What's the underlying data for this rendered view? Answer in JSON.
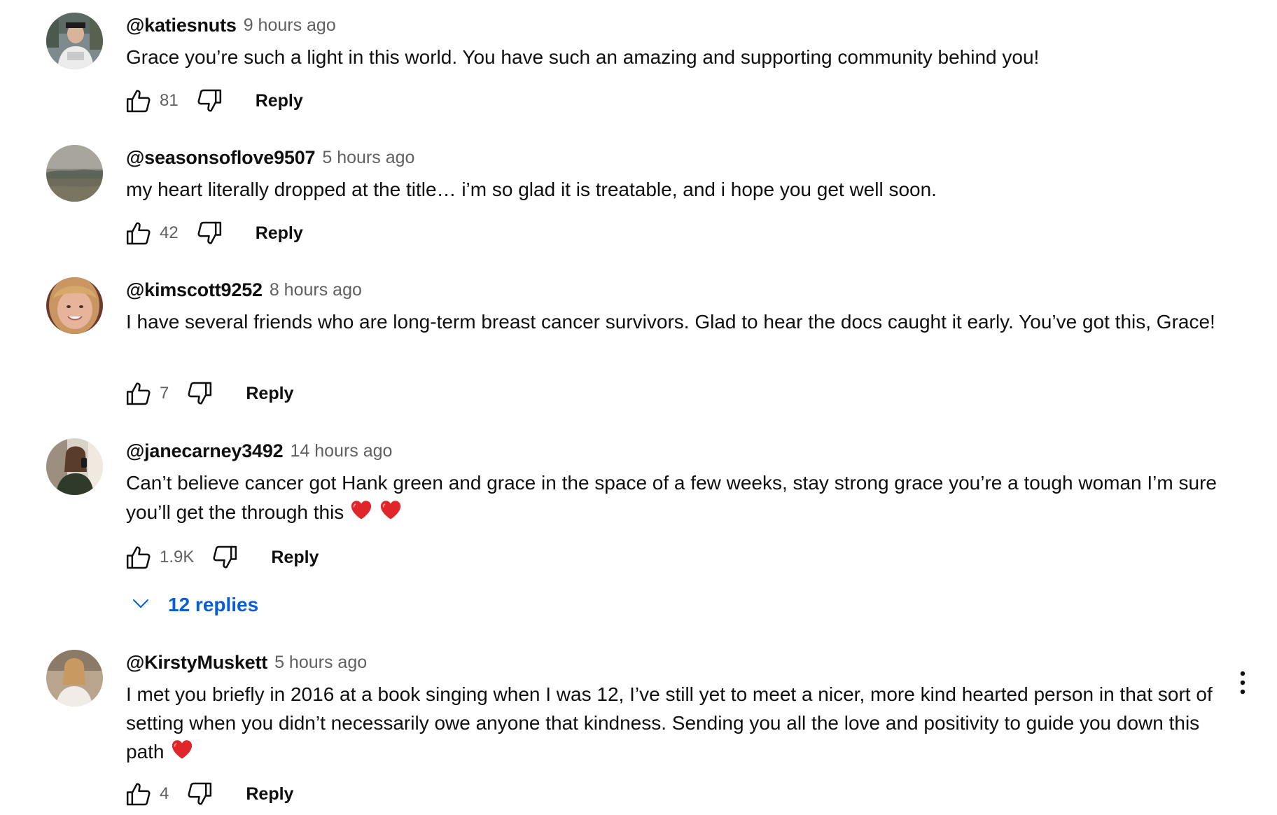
{
  "comments": [
    {
      "author": "@katiesnuts",
      "time": "9 hours ago",
      "text": "Grace you’re such a light in this world. You have such an amazing and supporting community behind you!",
      "likes": "81",
      "reply_label": "Reply",
      "avatar": "graduate-photo-avatar"
    },
    {
      "author": "@seasonsoflove9507",
      "time": "5 hours ago",
      "text": "my heart literally dropped at the title… i’m so glad it is treatable, and i hope you get well soon.",
      "likes": "42",
      "reply_label": "Reply",
      "avatar": "landscape-photo-avatar"
    },
    {
      "author": "@kimscott9252",
      "time": "8 hours ago",
      "text": "I have several friends who are long-term breast cancer survivors. Glad  to hear the docs caught it early. You’ve got this, Grace!",
      "likes": "7",
      "reply_label": "Reply",
      "avatar": "smiling-woman-avatar"
    },
    {
      "author": "@janecarney3492",
      "time": "14 hours ago",
      "text": "Can’t believe cancer got Hank green and grace in the space of a few weeks, stay strong grace you’re a tough woman I’m sure you’ll get the through this",
      "likes": "1.9K",
      "reply_label": "Reply",
      "replies_label": "12 replies",
      "avatar": "mirror-selfie-avatar"
    },
    {
      "author": "@KirstyMuskett",
      "time": "5 hours ago",
      "text": "I met you briefly in 2016 at a book singing when I was 12, I’ve still yet to meet a nicer, more kind hearted person in that sort of setting when you didn’t necessarily owe anyone that kindness. Sending you all the love and positivity to guide you down this path",
      "likes": "4",
      "reply_label": "Reply",
      "avatar": "woman-portrait-avatar"
    }
  ],
  "colors": {
    "text": "#0f0f0f",
    "secondary": "#606060",
    "link": "#065fd4",
    "heart": "#e0262b"
  },
  "icons": {
    "like": "thumbs-up-icon",
    "dislike": "thumbs-down-icon",
    "expand": "chevron-down-icon",
    "menu": "more-vert-icon",
    "emoji": "red-heart-emoji"
  }
}
